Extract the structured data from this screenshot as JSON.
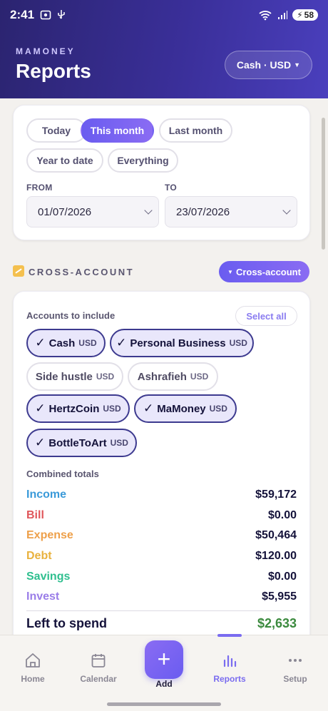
{
  "status_bar": {
    "time": "2:41",
    "battery": "58"
  },
  "header": {
    "brand": "MAMONEY",
    "title": "Reports",
    "account_selector": "Cash · USD"
  },
  "period": {
    "chips": [
      "Today",
      "This month",
      "Last month",
      "Year to date",
      "Everything"
    ],
    "active": "This month",
    "from_label": "FROM",
    "from_value": "01/07/2026",
    "to_label": "TO",
    "to_value": "23/07/2026"
  },
  "cross_account": {
    "section_title": "CROSS-ACCOUNT",
    "toggle_label": "Cross-account",
    "accounts_label": "Accounts to include",
    "select_all": "Select all",
    "accounts": [
      {
        "name": "Cash",
        "currency": "USD",
        "selected": true
      },
      {
        "name": "Personal Business",
        "currency": "USD",
        "selected": true
      },
      {
        "name": "Side hustle",
        "currency": "USD",
        "selected": false
      },
      {
        "name": "Ashrafieh",
        "currency": "USD",
        "selected": false
      },
      {
        "name": "HertzCoin",
        "currency": "USD",
        "selected": true
      },
      {
        "name": "MaMoney",
        "currency": "USD",
        "selected": true
      },
      {
        "name": "BottleToArt",
        "currency": "USD",
        "selected": true
      }
    ],
    "check_glyph": "✓",
    "totals_label": "Combined totals",
    "totals": [
      {
        "label": "Income",
        "value": "$59,172",
        "color": "#3a9ad9"
      },
      {
        "label": "Bill",
        "value": "$0.00",
        "color": "#e0575b"
      },
      {
        "label": "Expense",
        "value": "$50,464",
        "color": "#eea04a"
      },
      {
        "label": "Debt",
        "value": "$120.00",
        "color": "#e9b23e"
      },
      {
        "label": "Savings",
        "value": "$0.00",
        "color": "#2fbf8f"
      },
      {
        "label": "Invest",
        "value": "$5,955",
        "color": "#9a7de8"
      }
    ],
    "left_to_spend_label": "Left to spend",
    "left_to_spend_value": "$2,633"
  },
  "nav": {
    "items": [
      {
        "label": "Home",
        "icon": "home-icon"
      },
      {
        "label": "Calendar",
        "icon": "calendar-icon"
      },
      {
        "label": "Add",
        "icon": "plus-icon"
      },
      {
        "label": "Reports",
        "icon": "bar-chart-icon"
      },
      {
        "label": "Setup",
        "icon": "more-icon"
      }
    ],
    "active": "Reports"
  }
}
